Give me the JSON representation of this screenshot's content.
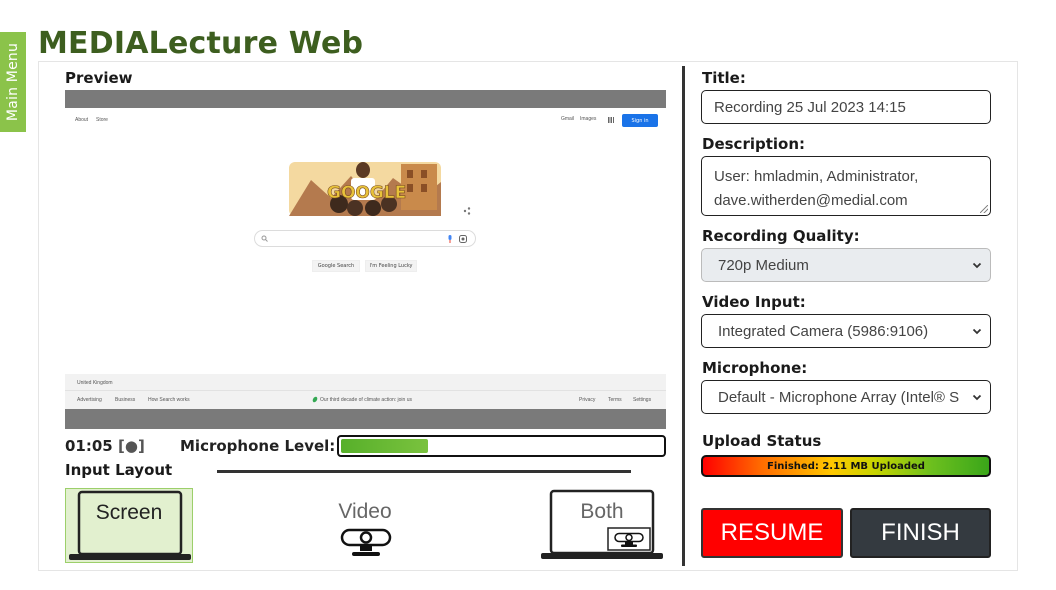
{
  "app": {
    "title": "MEDIALecture Web",
    "main_menu_label": "Main Menu"
  },
  "preview": {
    "label": "Preview",
    "screenshot": {
      "nav_left": [
        "About",
        "Store"
      ],
      "nav_right": [
        "Gmail",
        "Images"
      ],
      "sign_in": "Sign in",
      "buttons": [
        "Google Search",
        "I'm Feeling Lucky"
      ],
      "country": "United Kingdom",
      "footer_left": [
        "Advertising",
        "Business",
        "How Search works"
      ],
      "footer_center": "Our third decade of climate action: join us",
      "footer_right": [
        "Privacy",
        "Terms",
        "Settings"
      ]
    }
  },
  "status": {
    "timer": "01:05",
    "record_indicator": "[●]",
    "mic_label": "Microphone Level:",
    "mic_level": 0.27
  },
  "layout": {
    "label": "Input Layout",
    "options": [
      {
        "id": "screen",
        "label": "Screen",
        "selected": true
      },
      {
        "id": "video",
        "label": "Video",
        "selected": false
      },
      {
        "id": "both",
        "label": "Both",
        "selected": false
      }
    ]
  },
  "form": {
    "title_label": "Title:",
    "title_value": "Recording 25 Jul 2023 14:15",
    "description_label": "Description:",
    "description_value": "User: hmladmin, Administrator, dave.witherden@medial.com",
    "quality_label": "Recording Quality:",
    "quality_value": "720p Medium",
    "video_label": "Video Input:",
    "video_value": "Integrated Camera (5986:9106)",
    "mic_label": "Microphone:",
    "mic_value": "Default - Microphone Array (Intel® S",
    "upload_label": "Upload Status",
    "upload_text": "Finished: 2.11 MB Uploaded"
  },
  "actions": {
    "resume": "RESUME",
    "finish": "FINISH"
  },
  "colors": {
    "brand_green": "#3d5e1f",
    "tab_green": "#8bc34a",
    "resume_red": "#ff0000",
    "finish_dark": "#343a40"
  }
}
